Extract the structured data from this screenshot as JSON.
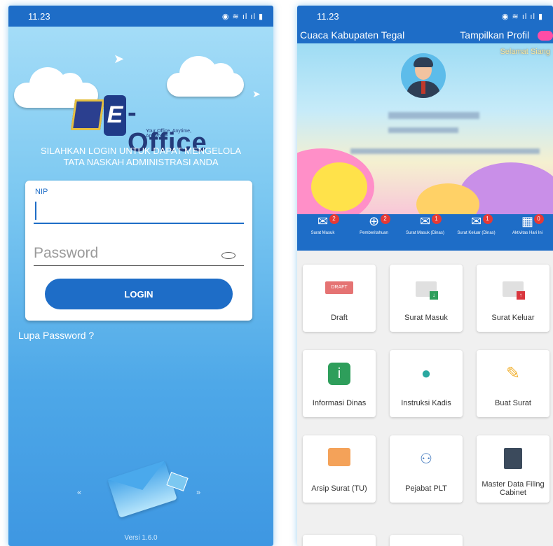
{
  "left": {
    "status_time": "11.23",
    "status_icons": "◉ ≋ ıl ıl ▮",
    "logo": {
      "text": "-Office",
      "letter": "E",
      "tagline": "Your Office, Anytime, Anywhere"
    },
    "login_message": "SILAHKAN LOGIN UNTUK DAPAT MENGELOLA TATA NASKAH ADMINISTRASI ANDA",
    "nip_label": "NIP",
    "nip_value": "",
    "password_placeholder": "Password",
    "login_button": "LOGIN",
    "forgot_password": "Lupa Password ?",
    "version": "Versi 1.6.0",
    "arrow_left": "«",
    "arrow_right": "»"
  },
  "right": {
    "status_time": "11.23",
    "status_icons": "◉ ≋ ıl ıl ▮",
    "weather_link": "Cuaca Kabupaten Tegal",
    "profile_toggle_label": "Tampilkan Profil",
    "greeting": "Selamat Siang",
    "quick_access": [
      {
        "label": "Surat Masuk",
        "badge": "2",
        "icon": "envelope-icon"
      },
      {
        "label": "Pemberitahuan",
        "badge": "2",
        "icon": "globe-icon"
      },
      {
        "label": "Surat Masuk (Dinas)",
        "badge": "1",
        "icon": "inbox-icon"
      },
      {
        "label": "Surat Keluar (Dinas)",
        "badge": "1",
        "icon": "outbox-icon"
      },
      {
        "label": "Aktivitas Hari Ini",
        "badge": "0",
        "icon": "calendar-icon"
      }
    ],
    "tiles": [
      {
        "label": "Draft",
        "icon": "draft-icon",
        "icon_text": "DRAFT"
      },
      {
        "label": "Surat Masuk",
        "icon": "mail-in-icon"
      },
      {
        "label": "Surat Keluar",
        "icon": "mail-out-icon"
      },
      {
        "label": "Informasi Dinas",
        "icon": "info-icon"
      },
      {
        "label": "Instruksi Kadis",
        "icon": "instruction-icon"
      },
      {
        "label": "Buat Surat",
        "icon": "pencil-icon"
      },
      {
        "label": "Arsip Surat (TU)",
        "icon": "archive-folder-icon"
      },
      {
        "label": "Pejabat PLT",
        "icon": "officials-icon"
      },
      {
        "label": "Master Data Filing Cabinet",
        "icon": "filing-cabinet-icon"
      }
    ],
    "colors": {
      "primary": "#1e6dc7",
      "badge": "#e53935",
      "toggle": "#ff4da6"
    }
  }
}
